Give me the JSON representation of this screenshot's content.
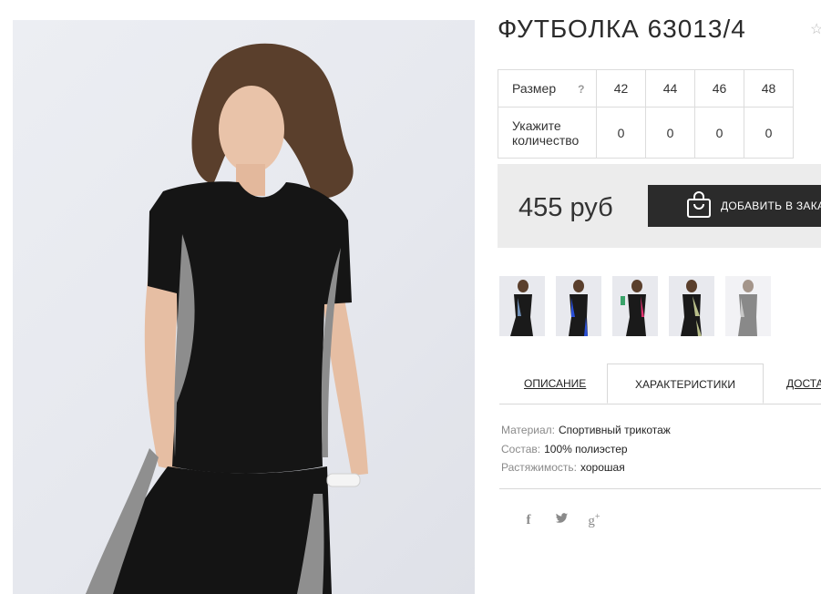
{
  "product": {
    "title": "ФУТБОЛКА 63013/4",
    "price": "455 руб"
  },
  "size_table": {
    "size_label": "Размер",
    "help_mark": "?",
    "sizes": [
      "42",
      "44",
      "46",
      "48"
    ],
    "qty_label_line1": "Укажите",
    "qty_label_line2": "количество",
    "quantities": [
      "0",
      "0",
      "0",
      "0"
    ]
  },
  "cart": {
    "button_label": "ДОБАВИТЬ В ЗАКАЗ"
  },
  "tabs": [
    {
      "label": "ОПИСАНИЕ"
    },
    {
      "label": "ХАРАКТЕРИСТИКИ",
      "active": true
    },
    {
      "label": "ДОСТАВКА"
    }
  ],
  "specs": [
    {
      "key": "Материал:",
      "value": "Спортивный трикотаж"
    },
    {
      "key": "Состав:",
      "value": "100% полиэстер"
    },
    {
      "key": "Растяжимость:",
      "value": "хорошая"
    }
  ],
  "thumbnails": [
    {
      "accent": "#6f8fb8"
    },
    {
      "accent": "#2a4fd6"
    },
    {
      "accent": "#e0336f"
    },
    {
      "accent": "#b8be8a"
    },
    {
      "accent": "#9a9a9a"
    }
  ],
  "social": [
    "facebook-icon",
    "twitter-icon",
    "google-plus-icon"
  ],
  "colors": {
    "dark": "#2b2b2b",
    "band": "#ececec",
    "border": "#dcdcdc",
    "muted": "#8a8a8a"
  }
}
